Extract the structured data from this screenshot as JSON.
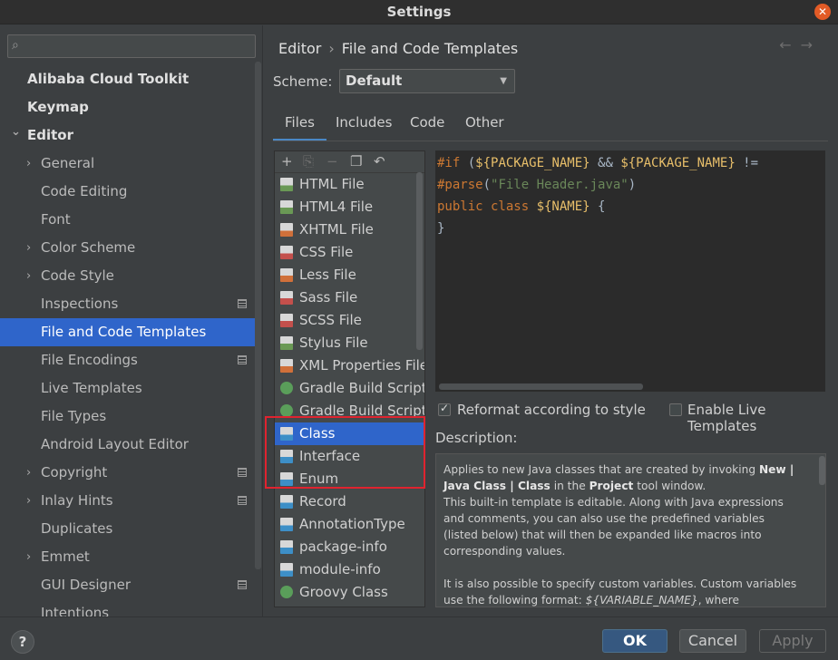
{
  "window": {
    "title": "Settings"
  },
  "sidebar": {
    "search": {
      "placeholder": "",
      "value": ""
    },
    "items": [
      {
        "label": "Alibaba Cloud Toolkit",
        "bold": true
      },
      {
        "label": "Keymap",
        "bold": true
      },
      {
        "label": "Editor",
        "bold": true,
        "expanded": true
      },
      {
        "label": "General",
        "chevron": "right"
      },
      {
        "label": "Code Editing"
      },
      {
        "label": "Font"
      },
      {
        "label": "Color Scheme",
        "chevron": "right"
      },
      {
        "label": "Code Style",
        "chevron": "right"
      },
      {
        "label": "Inspections",
        "badge": true
      },
      {
        "label": "File and Code Templates",
        "selected": true
      },
      {
        "label": "File Encodings",
        "badge": true
      },
      {
        "label": "Live Templates"
      },
      {
        "label": "File Types"
      },
      {
        "label": "Android Layout Editor"
      },
      {
        "label": "Copyright",
        "chevron": "right",
        "badge": true
      },
      {
        "label": "Inlay Hints",
        "chevron": "right",
        "badge": true
      },
      {
        "label": "Duplicates"
      },
      {
        "label": "Emmet",
        "chevron": "right"
      },
      {
        "label": "GUI Designer",
        "badge": true
      },
      {
        "label": "Intentions"
      }
    ]
  },
  "breadcrumb": {
    "parent": "Editor",
    "separator": "›",
    "current": "File and Code Templates"
  },
  "nav": {
    "back": "←",
    "forward": "→"
  },
  "scheme": {
    "label": "Scheme:",
    "value": "Default"
  },
  "tabs": [
    "Files",
    "Includes",
    "Code",
    "Other"
  ],
  "active_tab": "Files",
  "templates": [
    {
      "label": "HTML File",
      "icon": "html-file-icon",
      "color": "#6a9955"
    },
    {
      "label": "HTML4 File",
      "icon": "html-file-icon",
      "color": "#6a9955"
    },
    {
      "label": "XHTML File",
      "icon": "xhtml-file-icon",
      "color": "#d0703a"
    },
    {
      "label": "CSS File",
      "icon": "css-file-icon",
      "color": "#c4504c"
    },
    {
      "label": "Less File",
      "icon": "less-file-icon",
      "color": "#d0703a"
    },
    {
      "label": "Sass File",
      "icon": "sass-file-icon",
      "color": "#c4504c"
    },
    {
      "label": "SCSS File",
      "icon": "scss-file-icon",
      "color": "#c4504c"
    },
    {
      "label": "Stylus File",
      "icon": "stylus-file-icon",
      "color": "#6a9955"
    },
    {
      "label": "XML Properties File",
      "icon": "xml-file-icon",
      "color": "#d0703a"
    },
    {
      "label": "Gradle Build Script",
      "icon": "gradle-icon",
      "color": "#5a9e5a",
      "round": true
    },
    {
      "label": "Gradle Build Script w",
      "icon": "gradle-icon",
      "color": "#5a9e5a",
      "round": true
    },
    {
      "label": "Class",
      "icon": "java-file-icon",
      "color": "#3d8fc7",
      "selected": true
    },
    {
      "label": "Interface",
      "icon": "java-file-icon",
      "color": "#3d8fc7"
    },
    {
      "label": "Enum",
      "icon": "java-file-icon",
      "color": "#3d8fc7"
    },
    {
      "label": "Record",
      "icon": "java-file-icon",
      "color": "#3d8fc7"
    },
    {
      "label": "AnnotationType",
      "icon": "java-file-icon",
      "color": "#3d8fc7"
    },
    {
      "label": "package-info",
      "icon": "java-file-icon",
      "color": "#3d8fc7"
    },
    {
      "label": "module-info",
      "icon": "java-file-icon",
      "color": "#3d8fc7"
    },
    {
      "label": "Groovy Class",
      "icon": "groovy-icon",
      "color": "#5a9e5a",
      "round": true
    }
  ],
  "editor": {
    "lines": [
      [
        [
          "kw",
          "#if "
        ],
        [
          "plain",
          "("
        ],
        [
          "var",
          "${PACKAGE_NAME}"
        ],
        [
          "plain",
          " && "
        ],
        [
          "var",
          "${PACKAGE_NAME}"
        ],
        [
          "plain",
          " != "
        ]
      ],
      [
        [
          "kw",
          "#parse"
        ],
        [
          "plain",
          "("
        ],
        [
          "str",
          "\"File Header.java\""
        ],
        [
          "plain",
          ")"
        ]
      ],
      [
        [
          "kw",
          "public class "
        ],
        [
          "var",
          "${NAME}"
        ],
        [
          "plain",
          " {"
        ]
      ],
      [
        [
          "plain",
          "}"
        ]
      ]
    ]
  },
  "options": {
    "reformat": {
      "label": "Reformat according to style",
      "checked": true
    },
    "live_templates": {
      "label": "Enable Live Templates",
      "checked": false
    }
  },
  "description": {
    "label": "Description:",
    "html": "<p>Applies to new Java classes that are created by invoking <b>New | Java Class | Class</b> in the <b>Project</b> tool window.<br>This built-in template is editable. Along with Java expressions and comments, you can also use the predefined variables (listed below) that will then be expanded like macros into corresponding values.</p><p>It is also possible to specify custom variables. Custom variables use the following format: <i>${VARIABLE_NAME}</i>, where <i>VARIABLE_NAME</i> is a name for your variable (for example,</p>"
  },
  "buttons": {
    "help": "?",
    "ok": "OK",
    "cancel": "Cancel",
    "apply": "Apply"
  },
  "accent": "#2f65ca"
}
